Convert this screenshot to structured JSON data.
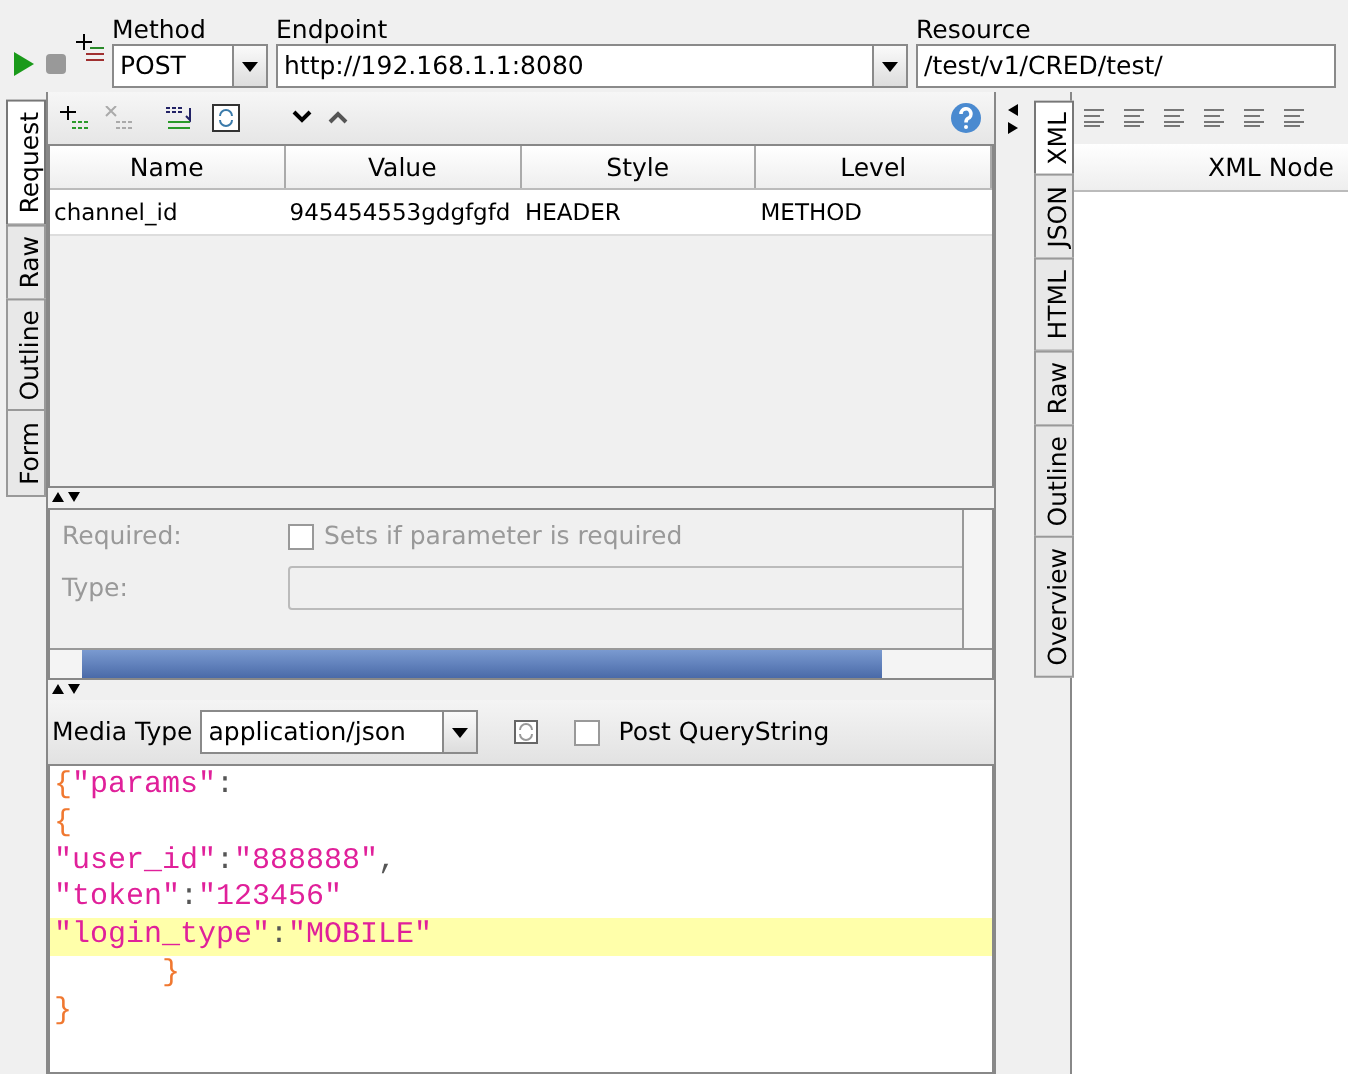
{
  "toolbar": {
    "method": {
      "label": "Method",
      "value": "POST"
    },
    "endpoint": {
      "label": "Endpoint",
      "value": "http://192.168.1.1:8080"
    },
    "resource": {
      "label": "Resource",
      "value": "/test/v1/CRED/test/"
    }
  },
  "request_tabs": [
    {
      "label": "Request",
      "selected": true
    },
    {
      "label": "Raw",
      "selected": false
    },
    {
      "label": "Outline",
      "selected": false
    },
    {
      "label": "Form",
      "selected": false
    }
  ],
  "params_table": {
    "columns": [
      "Name",
      "Value",
      "Style",
      "Level"
    ],
    "rows": [
      [
        "channel_id",
        "945454553gdgfgfd",
        "HEADER",
        "METHOD"
      ]
    ]
  },
  "param_details": {
    "required_label": "Required:",
    "required_checkbox": {
      "label": "Sets if parameter is required",
      "checked": false
    },
    "type_label": "Type:"
  },
  "media_type": {
    "label": "Media Type",
    "value": "application/json",
    "post_querystring": {
      "label": "Post QueryString",
      "checked": false
    }
  },
  "body_lines": [
    {
      "text": "{\"params\":",
      "highlighted": false
    },
    {
      "text": "{",
      "highlighted": false
    },
    {
      "text": "\"user_id\":\"888888\",",
      "highlighted": false
    },
    {
      "text": "\"token\":\"123456\"",
      "highlighted": false
    },
    {
      "text": "\"login_type\":\"MOBILE\"",
      "highlighted": true
    },
    {
      "text": "      }",
      "highlighted": false
    },
    {
      "text": "}",
      "highlighted": false
    }
  ],
  "response_tabs": [
    {
      "label": "XML",
      "selected": true
    },
    {
      "label": "JSON",
      "selected": false
    },
    {
      "label": "HTML",
      "selected": false
    },
    {
      "label": "Raw",
      "selected": false
    },
    {
      "label": "Outline",
      "selected": false
    },
    {
      "label": "Overview",
      "selected": false
    }
  ],
  "response_table": {
    "columns": [
      "XML Node"
    ]
  }
}
